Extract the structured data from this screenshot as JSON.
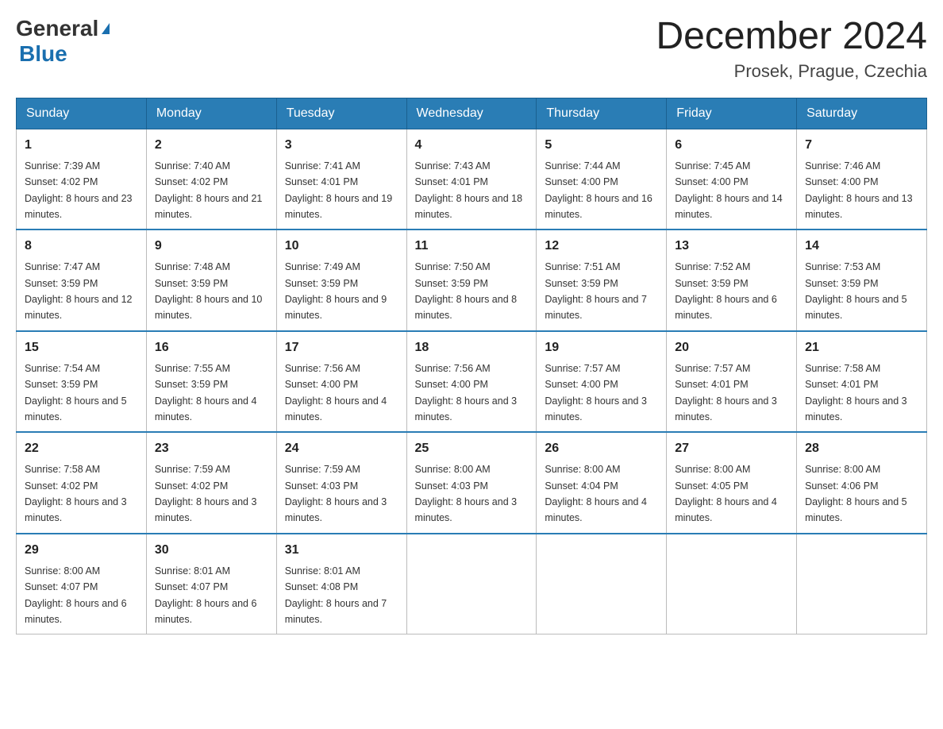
{
  "header": {
    "logo_general": "General",
    "logo_blue": "Blue",
    "main_title": "December 2024",
    "subtitle": "Prosek, Prague, Czechia"
  },
  "days_of_week": [
    "Sunday",
    "Monday",
    "Tuesday",
    "Wednesday",
    "Thursday",
    "Friday",
    "Saturday"
  ],
  "weeks": [
    [
      {
        "day": "1",
        "sunrise": "7:39 AM",
        "sunset": "4:02 PM",
        "daylight": "8 hours and 23 minutes."
      },
      {
        "day": "2",
        "sunrise": "7:40 AM",
        "sunset": "4:02 PM",
        "daylight": "8 hours and 21 minutes."
      },
      {
        "day": "3",
        "sunrise": "7:41 AM",
        "sunset": "4:01 PM",
        "daylight": "8 hours and 19 minutes."
      },
      {
        "day": "4",
        "sunrise": "7:43 AM",
        "sunset": "4:01 PM",
        "daylight": "8 hours and 18 minutes."
      },
      {
        "day": "5",
        "sunrise": "7:44 AM",
        "sunset": "4:00 PM",
        "daylight": "8 hours and 16 minutes."
      },
      {
        "day": "6",
        "sunrise": "7:45 AM",
        "sunset": "4:00 PM",
        "daylight": "8 hours and 14 minutes."
      },
      {
        "day": "7",
        "sunrise": "7:46 AM",
        "sunset": "4:00 PM",
        "daylight": "8 hours and 13 minutes."
      }
    ],
    [
      {
        "day": "8",
        "sunrise": "7:47 AM",
        "sunset": "3:59 PM",
        "daylight": "8 hours and 12 minutes."
      },
      {
        "day": "9",
        "sunrise": "7:48 AM",
        "sunset": "3:59 PM",
        "daylight": "8 hours and 10 minutes."
      },
      {
        "day": "10",
        "sunrise": "7:49 AM",
        "sunset": "3:59 PM",
        "daylight": "8 hours and 9 minutes."
      },
      {
        "day": "11",
        "sunrise": "7:50 AM",
        "sunset": "3:59 PM",
        "daylight": "8 hours and 8 minutes."
      },
      {
        "day": "12",
        "sunrise": "7:51 AM",
        "sunset": "3:59 PM",
        "daylight": "8 hours and 7 minutes."
      },
      {
        "day": "13",
        "sunrise": "7:52 AM",
        "sunset": "3:59 PM",
        "daylight": "8 hours and 6 minutes."
      },
      {
        "day": "14",
        "sunrise": "7:53 AM",
        "sunset": "3:59 PM",
        "daylight": "8 hours and 5 minutes."
      }
    ],
    [
      {
        "day": "15",
        "sunrise": "7:54 AM",
        "sunset": "3:59 PM",
        "daylight": "8 hours and 5 minutes."
      },
      {
        "day": "16",
        "sunrise": "7:55 AM",
        "sunset": "3:59 PM",
        "daylight": "8 hours and 4 minutes."
      },
      {
        "day": "17",
        "sunrise": "7:56 AM",
        "sunset": "4:00 PM",
        "daylight": "8 hours and 4 minutes."
      },
      {
        "day": "18",
        "sunrise": "7:56 AM",
        "sunset": "4:00 PM",
        "daylight": "8 hours and 3 minutes."
      },
      {
        "day": "19",
        "sunrise": "7:57 AM",
        "sunset": "4:00 PM",
        "daylight": "8 hours and 3 minutes."
      },
      {
        "day": "20",
        "sunrise": "7:57 AM",
        "sunset": "4:01 PM",
        "daylight": "8 hours and 3 minutes."
      },
      {
        "day": "21",
        "sunrise": "7:58 AM",
        "sunset": "4:01 PM",
        "daylight": "8 hours and 3 minutes."
      }
    ],
    [
      {
        "day": "22",
        "sunrise": "7:58 AM",
        "sunset": "4:02 PM",
        "daylight": "8 hours and 3 minutes."
      },
      {
        "day": "23",
        "sunrise": "7:59 AM",
        "sunset": "4:02 PM",
        "daylight": "8 hours and 3 minutes."
      },
      {
        "day": "24",
        "sunrise": "7:59 AM",
        "sunset": "4:03 PM",
        "daylight": "8 hours and 3 minutes."
      },
      {
        "day": "25",
        "sunrise": "8:00 AM",
        "sunset": "4:03 PM",
        "daylight": "8 hours and 3 minutes."
      },
      {
        "day": "26",
        "sunrise": "8:00 AM",
        "sunset": "4:04 PM",
        "daylight": "8 hours and 4 minutes."
      },
      {
        "day": "27",
        "sunrise": "8:00 AM",
        "sunset": "4:05 PM",
        "daylight": "8 hours and 4 minutes."
      },
      {
        "day": "28",
        "sunrise": "8:00 AM",
        "sunset": "4:06 PM",
        "daylight": "8 hours and 5 minutes."
      }
    ],
    [
      {
        "day": "29",
        "sunrise": "8:00 AM",
        "sunset": "4:07 PM",
        "daylight": "8 hours and 6 minutes."
      },
      {
        "day": "30",
        "sunrise": "8:01 AM",
        "sunset": "4:07 PM",
        "daylight": "8 hours and 6 minutes."
      },
      {
        "day": "31",
        "sunrise": "8:01 AM",
        "sunset": "4:08 PM",
        "daylight": "8 hours and 7 minutes."
      },
      null,
      null,
      null,
      null
    ]
  ]
}
